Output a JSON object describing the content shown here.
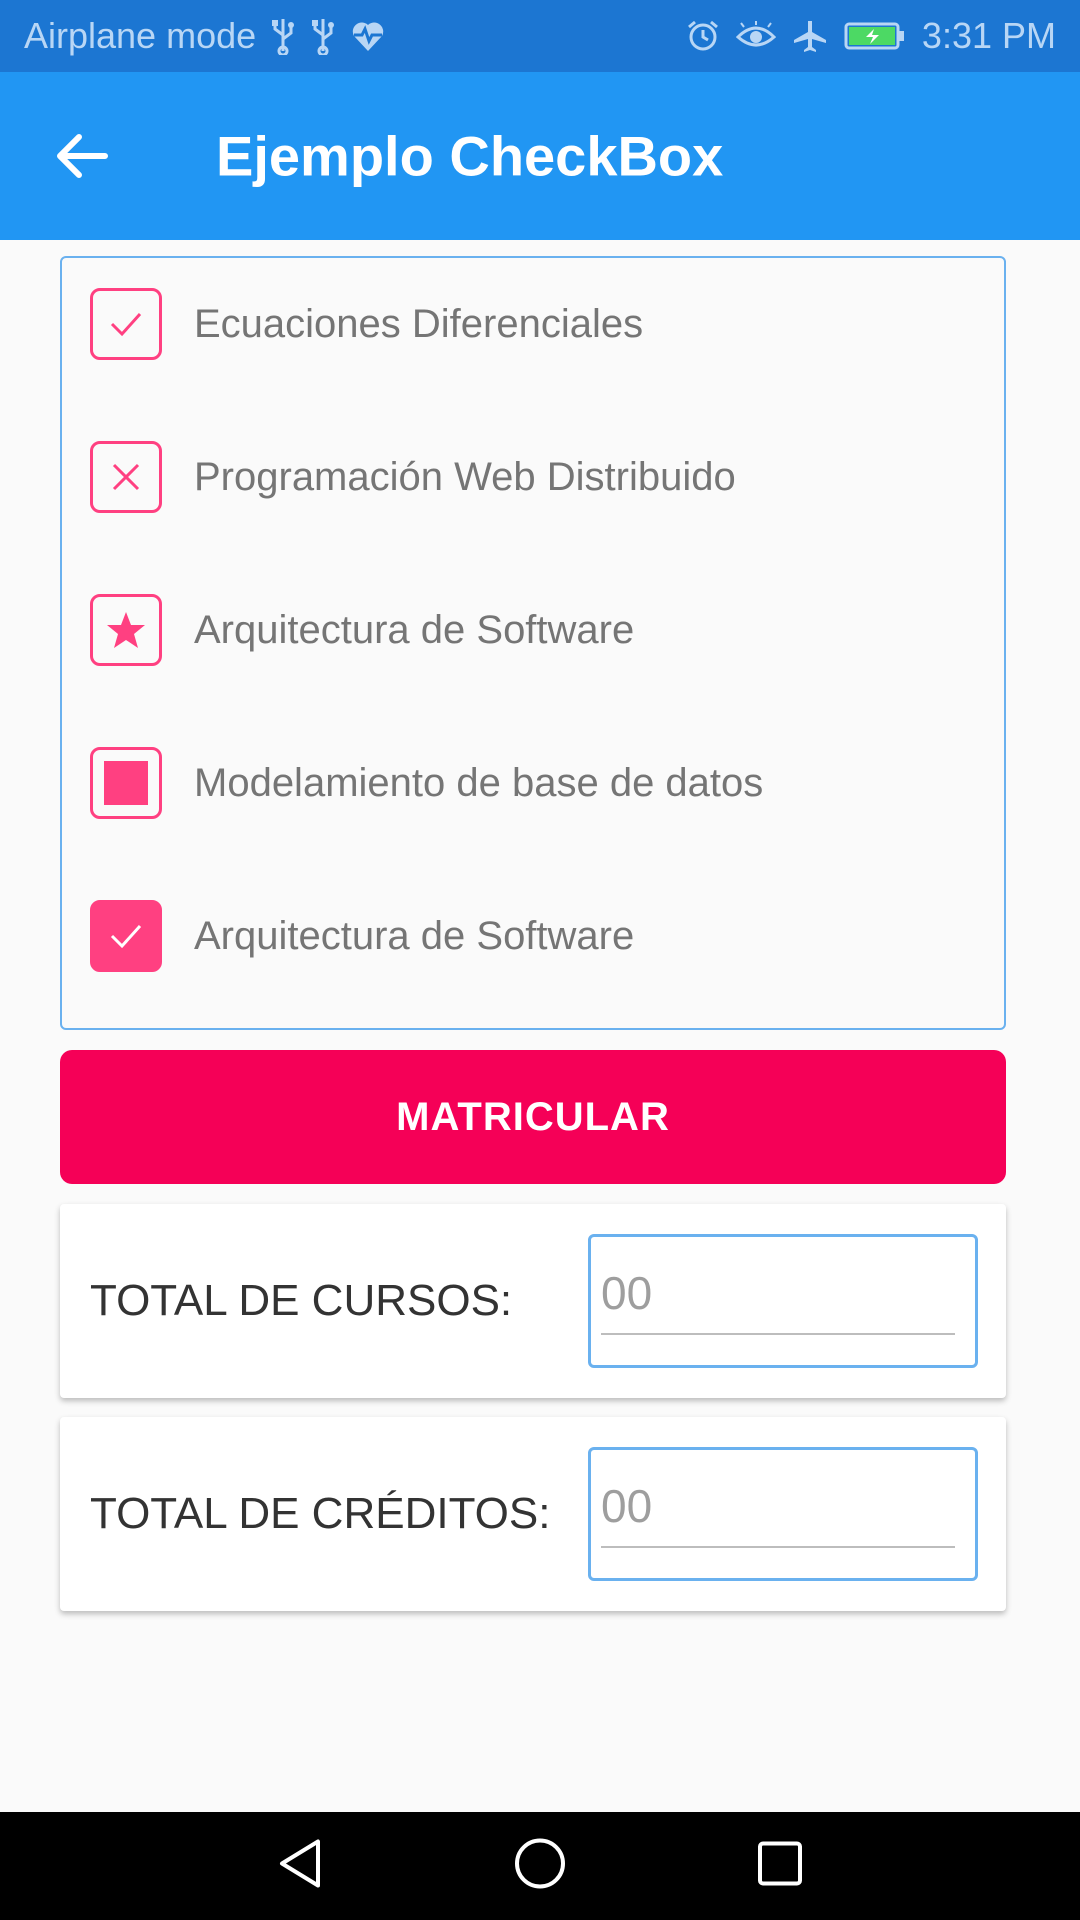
{
  "status_bar": {
    "left_text": "Airplane mode",
    "time": "3:31 PM",
    "icons_left": [
      "usb-icon",
      "usb-icon",
      "heart-pulse-icon"
    ],
    "icons_right": [
      "alarm-icon",
      "eye-icon",
      "airplane-icon",
      "battery-charging-icon"
    ]
  },
  "toolbar": {
    "title": "Ejemplo CheckBox",
    "back_icon": "arrow-left-icon",
    "background": "#2196f3"
  },
  "checkboxes": [
    {
      "label": "Ecuaciones Diferenciales",
      "style": "check-outline"
    },
    {
      "label": "Programación Web Distribuido",
      "style": "cross-outline"
    },
    {
      "label": "Arquitectura de Software",
      "style": "star-outline"
    },
    {
      "label": "Modelamiento de base de datos",
      "style": "square-outline"
    },
    {
      "label": "Arquitectura de Software",
      "style": "check-filled"
    }
  ],
  "button": {
    "label": "MATRICULAR",
    "color": "#f50057"
  },
  "totals": [
    {
      "label": "TOTAL DE CURSOS:",
      "placeholder": "00"
    },
    {
      "label": "TOTAL DE CRÉDITOS:",
      "placeholder": "00"
    }
  ],
  "accent_color": "#ff4081",
  "nav_bar": {
    "icons": [
      "back-triangle-icon",
      "home-circle-icon",
      "recents-square-icon"
    ]
  }
}
